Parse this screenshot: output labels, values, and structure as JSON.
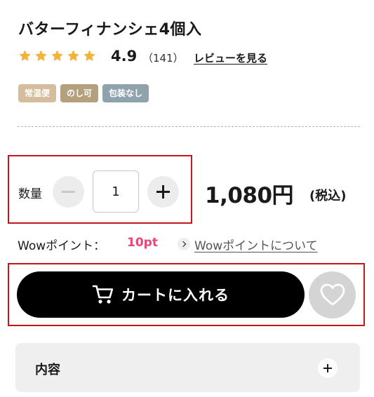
{
  "product": {
    "title": "バターフィナンシェ4個入",
    "rating": "4.9",
    "rating_stars": 5,
    "review_count": "（141）",
    "review_link": "レビューを見る",
    "star_color": "#f2b33d"
  },
  "badges": [
    {
      "label": "常温便",
      "color": "#d3bd9c"
    },
    {
      "label": "のし可",
      "color": "#b5a07e"
    },
    {
      "label": "包装なし",
      "color": "#8fa3ad"
    }
  ],
  "quantity": {
    "label": "数量",
    "value": "1",
    "minus_icon": "minus-icon",
    "plus_icon": "plus-icon"
  },
  "price": {
    "amount": "1,080円",
    "tax_note": "(税込)"
  },
  "wow_points": {
    "label": "Wowポイント：",
    "points": "10pt",
    "link": "Wowポイントについて",
    "points_color": "#e8457a"
  },
  "cart": {
    "button_label": "カートに入れる",
    "icon": "cart-icon",
    "favorite_icon": "heart-icon"
  },
  "accordion": {
    "title": "内容"
  },
  "highlight_color": "#c5161d"
}
